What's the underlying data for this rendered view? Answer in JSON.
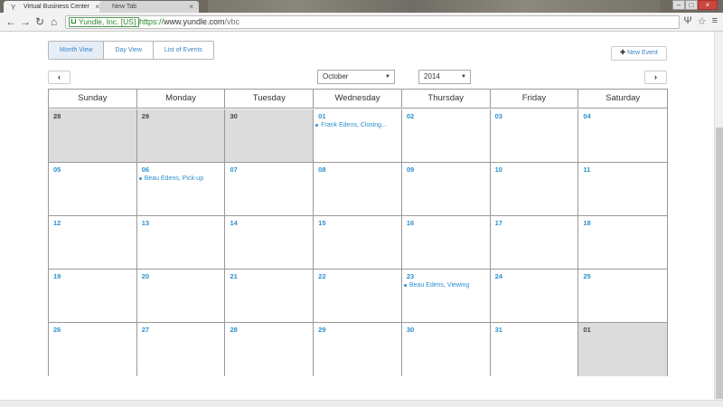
{
  "browser": {
    "tabs": [
      {
        "title": "Virtual Business Center",
        "active": true
      },
      {
        "title": "New Tab",
        "active": false
      }
    ],
    "ev_badge": "Yundle, Inc. [US]",
    "url_scheme": "https://",
    "url_host": "www.yundle.com",
    "url_path": "/vbc"
  },
  "view_tabs": [
    "Month View",
    "Day View",
    "List of Events"
  ],
  "active_view": "Month View",
  "new_event_label": "New Event",
  "month_select": "October",
  "year_select": "2014",
  "prev_label": "‹",
  "next_label": "›",
  "weekdays": [
    "Sunday",
    "Monday",
    "Tuesday",
    "Wednesday",
    "Thursday",
    "Friday",
    "Saturday"
  ],
  "weeks": [
    [
      {
        "day": "28",
        "other": true
      },
      {
        "day": "29",
        "other": true
      },
      {
        "day": "30",
        "other": true
      },
      {
        "day": "01",
        "event": "Frank Edens, Closing..."
      },
      {
        "day": "02"
      },
      {
        "day": "03"
      },
      {
        "day": "04"
      }
    ],
    [
      {
        "day": "05"
      },
      {
        "day": "06",
        "event": "Beau Edens, Pick-up"
      },
      {
        "day": "07"
      },
      {
        "day": "08"
      },
      {
        "day": "09"
      },
      {
        "day": "10"
      },
      {
        "day": "11"
      }
    ],
    [
      {
        "day": "12"
      },
      {
        "day": "13"
      },
      {
        "day": "14"
      },
      {
        "day": "15"
      },
      {
        "day": "16"
      },
      {
        "day": "17"
      },
      {
        "day": "18"
      }
    ],
    [
      {
        "day": "19"
      },
      {
        "day": "20"
      },
      {
        "day": "21"
      },
      {
        "day": "22"
      },
      {
        "day": "23",
        "event": "Beau Edens, Viewing"
      },
      {
        "day": "24"
      },
      {
        "day": "25"
      }
    ],
    [
      {
        "day": "26"
      },
      {
        "day": "27"
      },
      {
        "day": "28"
      },
      {
        "day": "29"
      },
      {
        "day": "30"
      },
      {
        "day": "31"
      },
      {
        "day": "01",
        "other": true
      }
    ]
  ],
  "colors": {
    "accent": "#2b8fd0",
    "other_month_bg": "#dcdcdc",
    "ev_green": "#2d862d"
  }
}
